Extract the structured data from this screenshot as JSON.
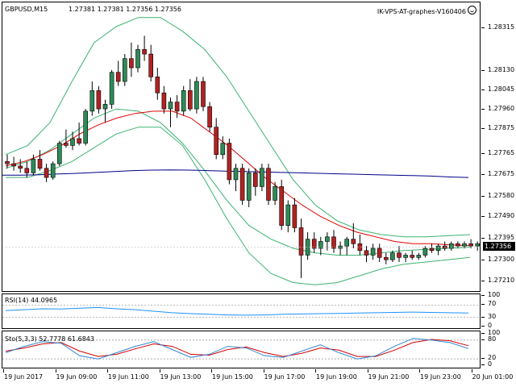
{
  "header": {
    "symbol": "GBPUSD,M15",
    "ohlc": "1.27381 1.27381 1.27356 1.27356",
    "expert": "IK-VPS-AT-graphes-V160406"
  },
  "rsi": {
    "label": "RSI(14) 44.0965",
    "levels": [
      "70",
      "30"
    ],
    "max": "100",
    "min": "0"
  },
  "stochastic": {
    "label": "Sto(5,3,3) 52.7778 61.6843",
    "levels": [
      "80",
      "20"
    ],
    "max": "100",
    "min": "0"
  },
  "price_axis": {
    "ticks": [
      "1.28315",
      "1.28130",
      "1.28045",
      "1.27960",
      "1.27875",
      "1.27765",
      "1.27675",
      "1.27580",
      "1.27490",
      "1.27395",
      "1.27300",
      "1.27210"
    ],
    "current": "1.27356"
  },
  "time_axis": {
    "labels": [
      "19 Jun 2017",
      "19 Jun 09:00",
      "19 Jun 11:00",
      "19 Jun 13:00",
      "19 Jun 15:00",
      "19 Jun 17:00",
      "19 Jun 19:00",
      "19 Jun 21:00",
      "19 Jun 23:00",
      "20 Jun 01:00"
    ]
  },
  "colors": {
    "bull": "#2e8b57",
    "bear": "#b22222",
    "ma_fast": "#e00000",
    "ma_slow": "#00008b",
    "band": "#3cb371",
    "rsi": "#1e90ff",
    "sto_main": "#2f86d6",
    "sto_signal": "#d40000",
    "level": "#a0a0a0"
  },
  "chart_data": {
    "type": "candlestick",
    "symbol": "GBPUSD",
    "timeframe": "M15",
    "ylim": [
      1.2717,
      1.2838
    ],
    "candles": [
      [
        1.2773,
        1.2776,
        1.277,
        1.2772
      ],
      [
        1.2772,
        1.2775,
        1.2769,
        1.2771
      ],
      [
        1.2771,
        1.2774,
        1.2768,
        1.277
      ],
      [
        1.277,
        1.2773,
        1.2766,
        1.2768
      ],
      [
        1.2768,
        1.2776,
        1.2767,
        1.2774
      ],
      [
        1.2774,
        1.2778,
        1.2769,
        1.277
      ],
      [
        1.277,
        1.2772,
        1.2764,
        1.2766
      ],
      [
        1.2766,
        1.2773,
        1.2765,
        1.2772
      ],
      [
        1.2772,
        1.2782,
        1.2771,
        1.2781
      ],
      [
        1.2781,
        1.2787,
        1.2779,
        1.278
      ],
      [
        1.278,
        1.2786,
        1.2778,
        1.2783
      ],
      [
        1.2783,
        1.279,
        1.278,
        1.2781
      ],
      [
        1.2781,
        1.2796,
        1.278,
        1.2795
      ],
      [
        1.2795,
        1.2808,
        1.2793,
        1.2804
      ],
      [
        1.2804,
        1.2806,
        1.2794,
        1.2796
      ],
      [
        1.2796,
        1.28,
        1.279,
        1.2798
      ],
      [
        1.2798,
        1.2813,
        1.2796,
        1.2812
      ],
      [
        1.2812,
        1.2817,
        1.2806,
        1.2808
      ],
      [
        1.2808,
        1.282,
        1.2806,
        1.2818
      ],
      [
        1.2818,
        1.2825,
        1.281,
        1.2814
      ],
      [
        1.2814,
        1.2824,
        1.2812,
        1.2822
      ],
      [
        1.2822,
        1.2828,
        1.2817,
        1.282
      ],
      [
        1.282,
        1.2824,
        1.2808,
        1.281
      ],
      [
        1.281,
        1.2814,
        1.28,
        1.2803
      ],
      [
        1.2803,
        1.2806,
        1.2794,
        1.2796
      ],
      [
        1.2796,
        1.2801,
        1.2788,
        1.2799
      ],
      [
        1.2799,
        1.2802,
        1.2792,
        1.2795
      ],
      [
        1.2795,
        1.2806,
        1.2793,
        1.2804
      ],
      [
        1.2804,
        1.2809,
        1.2795,
        1.2796
      ],
      [
        1.2796,
        1.281,
        1.2794,
        1.2808
      ],
      [
        1.2808,
        1.281,
        1.2795,
        1.2797
      ],
      [
        1.2797,
        1.2799,
        1.2786,
        1.2788
      ],
      [
        1.2788,
        1.2792,
        1.2774,
        1.2776
      ],
      [
        1.2776,
        1.2784,
        1.2774,
        1.2781
      ],
      [
        1.2781,
        1.2783,
        1.2763,
        1.2765
      ],
      [
        1.2765,
        1.2772,
        1.276,
        1.277
      ],
      [
        1.277,
        1.2772,
        1.2754,
        1.2756
      ],
      [
        1.2756,
        1.277,
        1.2753,
        1.2768
      ],
      [
        1.2768,
        1.277,
        1.2758,
        1.2762
      ],
      [
        1.2762,
        1.2772,
        1.276,
        1.277
      ],
      [
        1.277,
        1.2772,
        1.2754,
        1.2756
      ],
      [
        1.2756,
        1.2764,
        1.2754,
        1.2762
      ],
      [
        1.2762,
        1.2765,
        1.2743,
        1.2745
      ],
      [
        1.2745,
        1.2756,
        1.2742,
        1.2754
      ],
      [
        1.2754,
        1.2757,
        1.2742,
        1.2744
      ],
      [
        1.2744,
        1.2748,
        1.2722,
        1.2732
      ],
      [
        1.2732,
        1.2742,
        1.273,
        1.2739
      ],
      [
        1.2739,
        1.2742,
        1.2733,
        1.2735
      ],
      [
        1.2735,
        1.274,
        1.2732,
        1.2738
      ],
      [
        1.2738,
        1.2742,
        1.2734,
        1.274
      ],
      [
        1.274,
        1.2743,
        1.2733,
        1.2735
      ],
      [
        1.2735,
        1.2738,
        1.2732,
        1.2736
      ],
      [
        1.2736,
        1.274,
        1.2732,
        1.2739
      ],
      [
        1.2739,
        1.2746,
        1.2735,
        1.2737
      ],
      [
        1.2737,
        1.2741,
        1.2732,
        1.2734
      ],
      [
        1.2734,
        1.2736,
        1.2729,
        1.2732
      ],
      [
        1.2732,
        1.2737,
        1.273,
        1.2735
      ],
      [
        1.2735,
        1.2737,
        1.2729,
        1.2731
      ],
      [
        1.2731,
        1.2733,
        1.2728,
        1.273
      ],
      [
        1.273,
        1.2734,
        1.2729,
        1.2733
      ],
      [
        1.2733,
        1.2736,
        1.2729,
        1.2731
      ],
      [
        1.2731,
        1.2733,
        1.2729,
        1.2732
      ],
      [
        1.2732,
        1.2734,
        1.273,
        1.2731
      ],
      [
        1.2731,
        1.2733,
        1.273,
        1.2732
      ],
      [
        1.2732,
        1.2736,
        1.2731,
        1.2735
      ],
      [
        1.2735,
        1.2737,
        1.2733,
        1.2734
      ],
      [
        1.2734,
        1.2737,
        1.2732,
        1.2736
      ],
      [
        1.2736,
        1.2738,
        1.2734,
        1.2735
      ],
      [
        1.2735,
        1.2738,
        1.2734,
        1.2737
      ],
      [
        1.2737,
        1.2738,
        1.2735,
        1.2736
      ],
      [
        1.2736,
        1.2738,
        1.2735,
        1.2737
      ],
      [
        1.2737,
        1.2739,
        1.2735,
        1.2736
      ],
      [
        1.2736,
        1.2738,
        1.2734,
        1.2737
      ],
      [
        1.2737,
        1.2739,
        1.2735,
        1.2736
      ],
      [
        1.2736,
        1.2738,
        1.2734,
        1.2737
      ],
      [
        1.2737,
        1.27381,
        1.2735,
        1.27356
      ]
    ],
    "ma_fast": [
      1.2771,
      1.2773,
      1.2776,
      1.278,
      1.2785,
      1.2789,
      1.2792,
      1.2794,
      1.2795,
      1.2795,
      1.2792,
      1.2786,
      1.278,
      1.2773,
      1.2766,
      1.276,
      1.2754,
      1.2749,
      1.2745,
      1.2742,
      1.274,
      1.2738,
      1.2737,
      1.2737,
      1.27365,
      1.27362
    ],
    "ma_slow": [
      1.2767,
      1.2767,
      1.27672,
      1.27675,
      1.27678,
      1.27682,
      1.27686,
      1.2769,
      1.27692,
      1.27693,
      1.27692,
      1.2769,
      1.27688,
      1.27686,
      1.27684,
      1.27682,
      1.2768,
      1.27678,
      1.27676,
      1.27674,
      1.27672,
      1.2767,
      1.27668,
      1.27666,
      1.27662,
      1.2766
    ],
    "band_upper": [
      1.2776,
      1.278,
      1.279,
      1.2808,
      1.2825,
      1.2832,
      1.2836,
      1.2836,
      1.283,
      1.2822,
      1.281,
      1.2795,
      1.278,
      1.2765,
      1.2754,
      1.2747,
      1.2743,
      1.2741,
      1.274,
      1.274,
      1.27405,
      1.2741
    ],
    "band_lower": [
      1.2766,
      1.2766,
      1.2769,
      1.2773,
      1.2779,
      1.2785,
      1.2788,
      1.2788,
      1.278,
      1.2765,
      1.2748,
      1.2733,
      1.2724,
      1.272,
      1.2719,
      1.272,
      1.2723,
      1.2726,
      1.2728,
      1.2729,
      1.273,
      1.2731
    ],
    "band_mid": [
      1.277,
      1.2773,
      1.2778,
      1.2785,
      1.2792,
      1.2796,
      1.2795,
      1.279,
      1.2781,
      1.2769,
      1.2756,
      1.2745,
      1.2739,
      1.2735,
      1.2733,
      1.2732,
      1.2732,
      1.2733,
      1.2734,
      1.27345,
      1.2735,
      1.27355
    ],
    "rsi": [
      52,
      55,
      58,
      57,
      60,
      62,
      58,
      55,
      50,
      45,
      42,
      40,
      38,
      37,
      38,
      40,
      41,
      42,
      43,
      44,
      45,
      46,
      47,
      46,
      45,
      44
    ],
    "sto_main": [
      40,
      60,
      75,
      70,
      30,
      20,
      40,
      60,
      75,
      50,
      25,
      35,
      60,
      55,
      30,
      25,
      45,
      65,
      40,
      20,
      30,
      60,
      85,
      80,
      72,
      53
    ],
    "sto_signal": [
      45,
      55,
      68,
      72,
      45,
      28,
      35,
      52,
      68,
      60,
      35,
      32,
      50,
      58,
      40,
      28,
      38,
      55,
      48,
      28,
      28,
      48,
      72,
      82,
      78,
      62
    ]
  }
}
